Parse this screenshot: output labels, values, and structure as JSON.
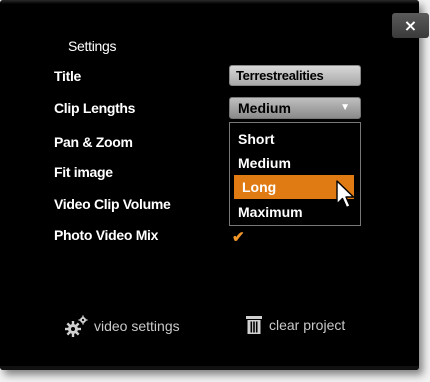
{
  "dialog": {
    "close_label": "×",
    "heading": "Settings"
  },
  "settings": {
    "title_label": "Title",
    "title_value": "Terrestrealities",
    "clip_lengths_label": "Clip Lengths",
    "clip_lengths_value": "Medium",
    "pan_zoom_label": "Pan & Zoom",
    "fit_image_label": "Fit image",
    "video_clip_volume_label": "Video Clip Volume",
    "photo_video_mix_label": "Photo Video Mix",
    "photo_video_mix_checked": "✔"
  },
  "clip_length_options": [
    {
      "label": "Short",
      "selected": false
    },
    {
      "label": "Medium",
      "selected": false
    },
    {
      "label": "Long",
      "selected": true
    },
    {
      "label": "Maximum",
      "selected": false
    }
  ],
  "footer": {
    "video_settings_label": "video settings",
    "clear_project_label": "clear project"
  },
  "colors": {
    "accent": "#e07b14",
    "background": "#000000"
  }
}
